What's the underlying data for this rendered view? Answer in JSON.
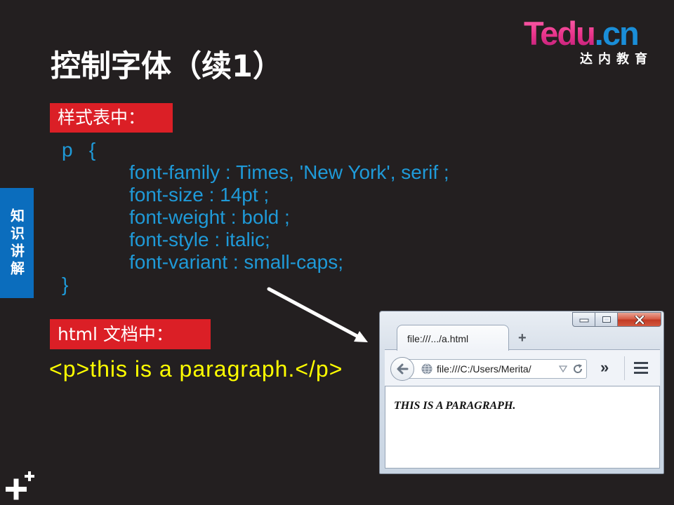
{
  "logo": {
    "brand_main": "Tedu",
    "brand_suffix": ".cn",
    "tagline": "达内教育"
  },
  "title": "控制字体（续1）",
  "side_tab": {
    "label": "知识讲解"
  },
  "stylesheet_section": {
    "label": "样式表中：",
    "selector_line": "p   {",
    "declarations": [
      "font-family : Times, 'New York', serif ;",
      "font-size : 14pt ;",
      "font-weight : bold ;",
      "font-style : italic;",
      "font-variant : small-caps;"
    ],
    "closing_brace": "}"
  },
  "html_section": {
    "label": "html 文档中：",
    "markup": "<p>this is a paragraph.</p>"
  },
  "browser": {
    "tab_title": "file:///.../a.html",
    "new_tab_label": "+",
    "url": "file:///C:/Users/Merita/",
    "overflow_label": "»",
    "page_text": "THIS IS A PARAGRAPH."
  },
  "icons": {
    "arrow": "arrow-icon",
    "minimize": "minimize-icon",
    "maximize": "maximize-icon",
    "close": "close-icon",
    "back": "back-arrow-icon",
    "globe": "globe-icon",
    "dropdown": "dropdown-triangle-icon",
    "reload": "reload-icon",
    "menu": "hamburger-menu-icon",
    "corner_plus": "plus-icon"
  },
  "colors": {
    "background": "#231f20",
    "label_red": "#db1f26",
    "code_blue": "#1f9ad8",
    "code_yellow": "#ffff00",
    "side_tab_blue": "#0b6dbd",
    "logo_pink": "#e8338a",
    "logo_blue": "#1a8ed8",
    "title_white": "#ffffff"
  }
}
